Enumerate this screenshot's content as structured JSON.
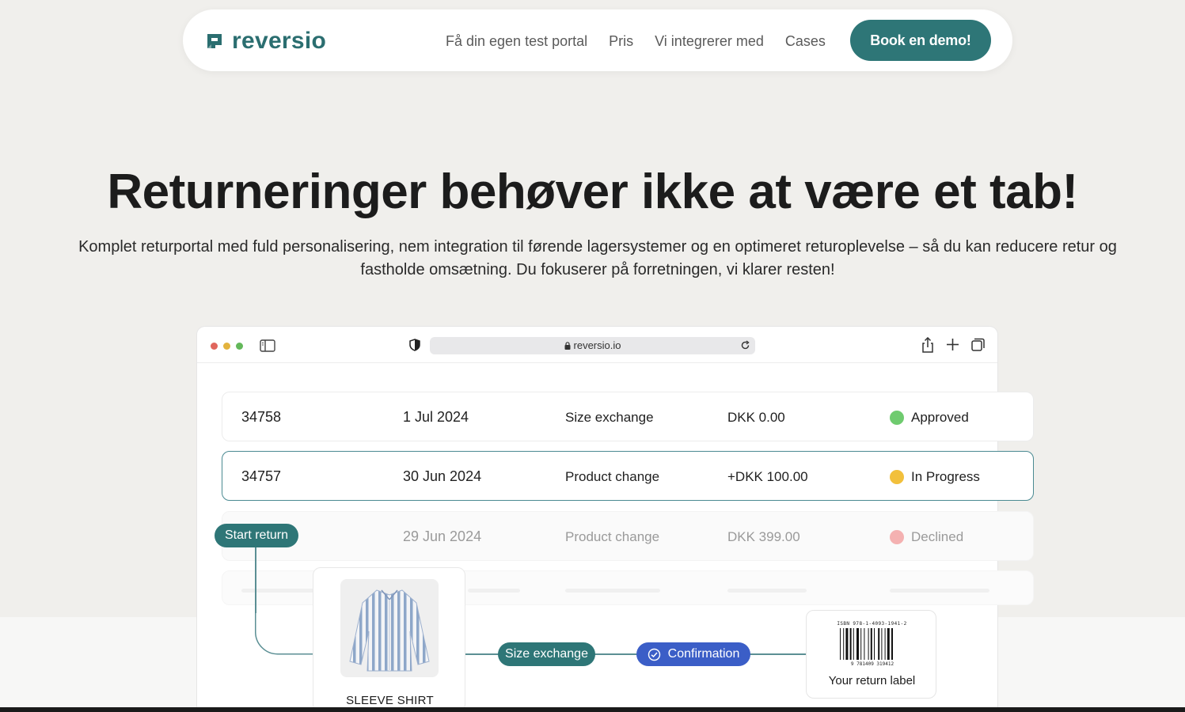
{
  "nav": {
    "logo_text": "reversio",
    "links": [
      "Få din egen test portal",
      "Pris",
      "Vi integrerer med",
      "Cases"
    ],
    "cta_label": "Book en demo!",
    "brand_color": "#2e7677"
  },
  "hero": {
    "title": "Returneringer behøver ikke at være et tab!",
    "subtitle_line1": "Komplet returportal med fuld personalisering, nem integration til førende lagersystemer og en optimeret returoplevelse – så du kan reducere retur og",
    "subtitle_line2": "fastholde omsætning. Du fokuserer på forretningen, vi klarer resten!"
  },
  "browser": {
    "url": "reversio.io",
    "icons": [
      "sidebar-icon",
      "shield-icon",
      "lock-icon",
      "reload-icon",
      "share-icon",
      "plus-icon",
      "tabs-icon"
    ]
  },
  "returns": [
    {
      "id": "34758",
      "date": "1 Jul 2024",
      "type": "Size exchange",
      "amount": "DKK 0.00",
      "status": "Approved",
      "status_color": "#6fcb6f"
    },
    {
      "id": "34757",
      "date": "30 Jun 2024",
      "type": "Product change",
      "amount": "+DKK 100.00",
      "status": "In Progress",
      "status_color": "#f2c03c"
    },
    {
      "id": "",
      "date": "29 Jun 2024",
      "type": "Product change",
      "amount": "DKK 399.00",
      "status": "Declined",
      "status_color": "#f4b1b1"
    }
  ],
  "flow": {
    "start_label": "Start return",
    "product_name": "SLEEVE SHIRT",
    "exchange_label": "Size exchange",
    "confirmation_label": "Confirmation",
    "isbn": "ISBN 978-1-4093-1941-2",
    "barcode_digits": "9 781409 319412",
    "label_text": "Your return label"
  }
}
